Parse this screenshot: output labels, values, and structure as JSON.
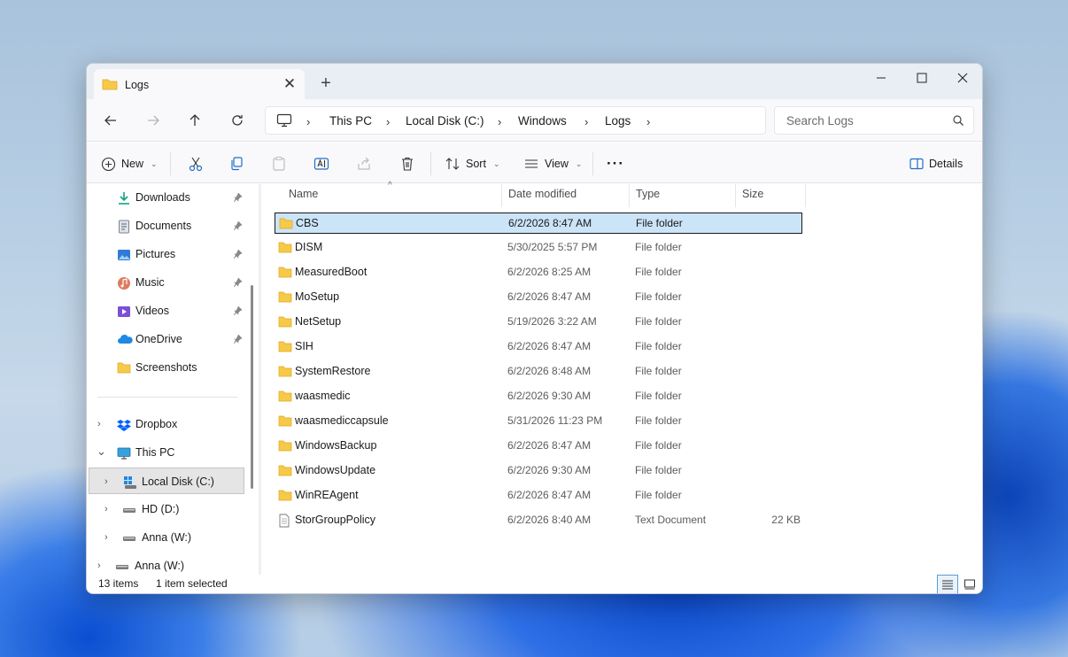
{
  "window": {
    "tab_title": "Logs",
    "tab_close": "✕",
    "new_tab": "+"
  },
  "address": {
    "crumbs": [
      "This PC",
      "Local Disk (C:)",
      "Windows",
      "Logs"
    ],
    "separator": "›"
  },
  "search": {
    "placeholder": "Search Logs"
  },
  "toolbar": {
    "new_label": "New",
    "sort_label": "Sort",
    "view_label": "View",
    "more_label": "···",
    "details_label": "Details"
  },
  "sidebar": {
    "quick_access": [
      {
        "label": "Downloads",
        "icon": "download-icon",
        "pinned": true
      },
      {
        "label": "Documents",
        "icon": "document-icon",
        "pinned": true
      },
      {
        "label": "Pictures",
        "icon": "pictures-icon",
        "pinned": true
      },
      {
        "label": "Music",
        "icon": "music-icon",
        "pinned": true
      },
      {
        "label": "Videos",
        "icon": "videos-icon",
        "pinned": true
      },
      {
        "label": "OneDrive",
        "icon": "onedrive-icon",
        "pinned": true
      },
      {
        "label": "Screenshots",
        "icon": "folder-icon",
        "pinned": false
      }
    ],
    "tree": [
      {
        "label": "Dropbox",
        "expander": "›",
        "icon": "dropbox-icon"
      },
      {
        "label": "This PC",
        "expander": "⌄",
        "icon": "monitor-icon"
      },
      {
        "label": "Local Disk (C:)",
        "expander": "›",
        "icon": "windows-drive-icon",
        "selected": true
      },
      {
        "label": "HD (D:)",
        "expander": "›",
        "icon": "drive-icon"
      },
      {
        "label": "Anna (W:)",
        "expander": "›",
        "icon": "drive-icon"
      },
      {
        "label": "Anna (W:)",
        "expander": "›",
        "icon": "drive-icon"
      }
    ]
  },
  "columns": [
    "Name",
    "Date modified",
    "Type",
    "Size"
  ],
  "sort_indicator": "^",
  "files": [
    {
      "name": "CBS",
      "date": "6/2/2026 8:47 AM",
      "type": "File folder",
      "size": "",
      "kind": "folder",
      "selected": true
    },
    {
      "name": "DISM",
      "date": "5/30/2025 5:57 PM",
      "type": "File folder",
      "size": "",
      "kind": "folder"
    },
    {
      "name": "MeasuredBoot",
      "date": "6/2/2026 8:25 AM",
      "type": "File folder",
      "size": "",
      "kind": "folder"
    },
    {
      "name": "MoSetup",
      "date": "6/2/2026 8:47 AM",
      "type": "File folder",
      "size": "",
      "kind": "folder"
    },
    {
      "name": "NetSetup",
      "date": "5/19/2026 3:22 AM",
      "type": "File folder",
      "size": "",
      "kind": "folder"
    },
    {
      "name": "SIH",
      "date": "6/2/2026 8:47 AM",
      "type": "File folder",
      "size": "",
      "kind": "folder"
    },
    {
      "name": "SystemRestore",
      "date": "6/2/2026 8:48 AM",
      "type": "File folder",
      "size": "",
      "kind": "folder"
    },
    {
      "name": "waasmedic",
      "date": "6/2/2026 9:30 AM",
      "type": "File folder",
      "size": "",
      "kind": "folder"
    },
    {
      "name": "waasmediccapsule",
      "date": "5/31/2026 11:23 PM",
      "type": "File folder",
      "size": "",
      "kind": "folder"
    },
    {
      "name": "WindowsBackup",
      "date": "6/2/2026 8:47 AM",
      "type": "File folder",
      "size": "",
      "kind": "folder"
    },
    {
      "name": "WindowsUpdate",
      "date": "6/2/2026 9:30 AM",
      "type": "File folder",
      "size": "",
      "kind": "folder"
    },
    {
      "name": "WinREAgent",
      "date": "6/2/2026 8:47 AM",
      "type": "File folder",
      "size": "",
      "kind": "folder"
    },
    {
      "name": "StorGroupPolicy",
      "date": "6/2/2026 8:40 AM",
      "type": "Text Document",
      "size": "22 KB",
      "kind": "text"
    }
  ],
  "status": {
    "count": "13 items",
    "selection": "1 item selected"
  },
  "colors": {
    "selection_bg": "#cce4f7",
    "folder_yellow": "#f7c948",
    "accent": "#0067c0"
  }
}
